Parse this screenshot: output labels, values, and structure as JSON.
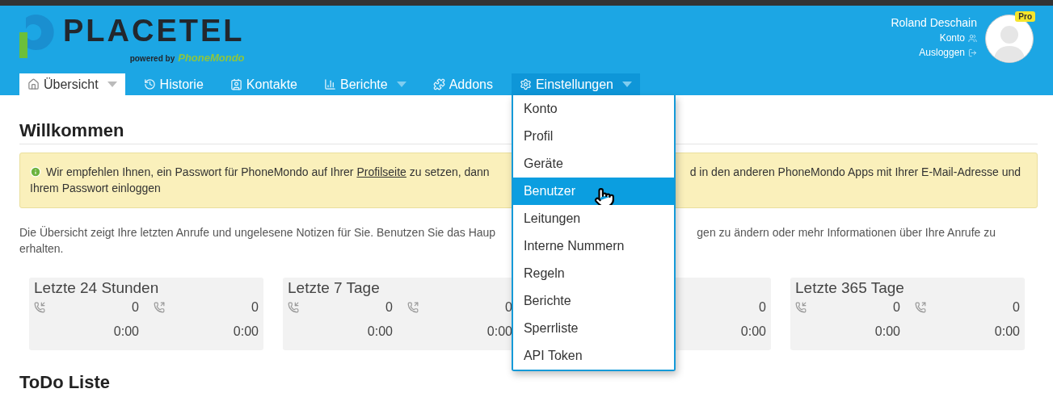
{
  "header": {
    "logo": {
      "name": "PLACETEL",
      "powered_by": "powered by",
      "brand": "PhoneMondo"
    },
    "user": {
      "name": "Roland Deschain",
      "badge": "Pro",
      "links": [
        {
          "label": "Konto",
          "kind": "account"
        },
        {
          "label": "Ausloggen",
          "kind": "logout"
        }
      ]
    }
  },
  "nav": [
    {
      "label": "Übersicht",
      "selected": true,
      "open": false,
      "dropdown": true
    },
    {
      "label": "Historie",
      "selected": false,
      "open": false,
      "dropdown": false
    },
    {
      "label": "Kontakte",
      "selected": false,
      "open": false,
      "dropdown": false
    },
    {
      "label": "Berichte",
      "selected": false,
      "open": false,
      "dropdown": true
    },
    {
      "label": "Addons",
      "selected": false,
      "open": false,
      "dropdown": false
    },
    {
      "label": "Einstellungen",
      "selected": false,
      "open": true,
      "dropdown": true
    }
  ],
  "settings_menu": [
    {
      "label": "Konto",
      "selected": false
    },
    {
      "label": "Profil",
      "selected": false
    },
    {
      "label": "Geräte",
      "selected": false
    },
    {
      "label": "Benutzer",
      "selected": true
    },
    {
      "label": "Leitungen",
      "selected": false
    },
    {
      "label": "Interne Nummern",
      "selected": false
    },
    {
      "label": "Regeln",
      "selected": false
    },
    {
      "label": "Berichte",
      "selected": false
    },
    {
      "label": "Sperrliste",
      "selected": false
    },
    {
      "label": "API Token",
      "selected": false
    }
  ],
  "title": "Willkommen",
  "alert": {
    "before_link": "Wir empfehlen Ihnen, ein Passwort für PhoneMondo auf Ihrer ",
    "link": "Profilseite",
    "after_link": " zu setzen, dann",
    "line1_right": "d in den anderen PhoneMondo Apps mit Ihrer E-Mail-Adresse und",
    "line2": "Ihrem Passwort einloggen"
  },
  "intro": {
    "line1_left": "Die Übersicht zeigt Ihre letzten Anrufe und ungelesene Notizen für Sie. Benutzen Sie das Haup",
    "line1_right": "gen zu ändern oder mehr Informationen über Ihre Anrufe zu",
    "line2": "erhalten."
  },
  "cards": [
    {
      "title": "Letzte 24 Stunden",
      "incoming": {
        "count": "0",
        "duration": "0:00"
      },
      "outgoing": {
        "count": "0",
        "duration": "0:00"
      }
    },
    {
      "title": "Letzte 7 Tage",
      "incoming": {
        "count": "0",
        "duration": "0:00"
      },
      "outgoing": {
        "count": "0",
        "duration": "0:00"
      }
    },
    {
      "outgoing": {
        "count": "0",
        "duration": "0:00"
      }
    },
    {
      "title": "Letzte 365 Tage",
      "incoming": {
        "count": "0",
        "duration": "0:00"
      },
      "outgoing": {
        "count": "0",
        "duration": "0:00"
      }
    }
  ],
  "todo_title": "ToDo Liste"
}
